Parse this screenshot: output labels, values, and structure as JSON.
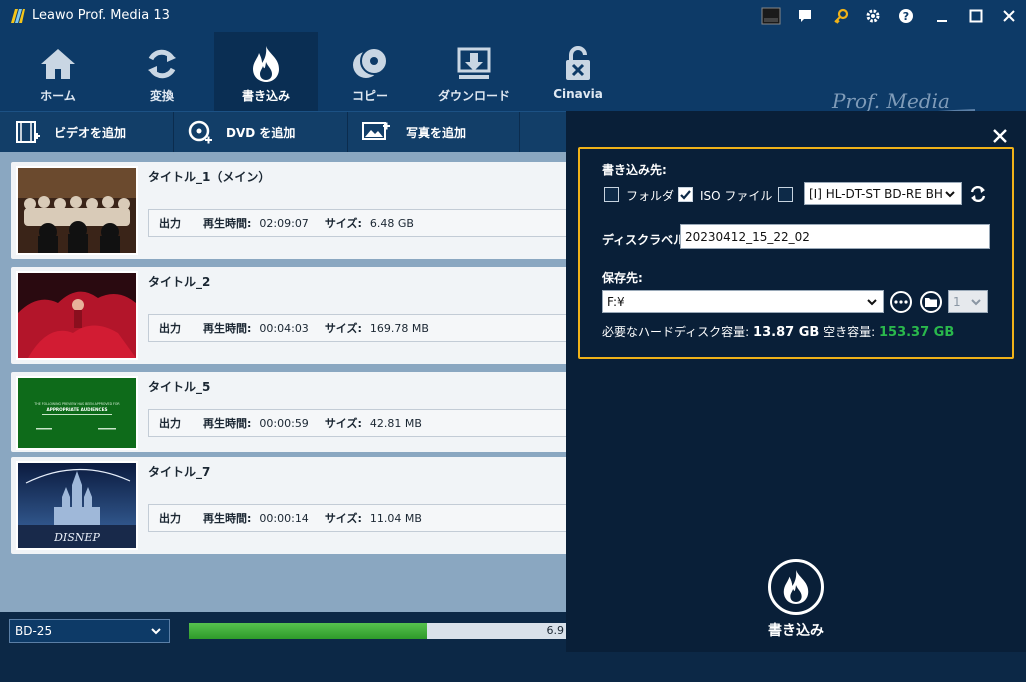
{
  "window": {
    "title": "Leawo Prof. Media 13",
    "brand": "Prof. Media"
  },
  "nav": {
    "items": [
      {
        "label": "ホーム",
        "icon": "home-icon"
      },
      {
        "label": "変換",
        "icon": "convert-icon"
      },
      {
        "label": "書き込み",
        "icon": "burn-icon",
        "active": true
      },
      {
        "label": "コピー",
        "icon": "copy-disc-icon"
      },
      {
        "label": "ダウンロード",
        "icon": "download-icon"
      },
      {
        "label": "Cinavia",
        "icon": "cinavia-lock-icon"
      }
    ]
  },
  "toolbar": {
    "add_video": "ビデオを追加",
    "add_dvd": "DVD を追加",
    "add_photo": "写真を追加"
  },
  "labels": {
    "output": "出力",
    "duration": "再生時間:",
    "size": "サイズ:"
  },
  "items": [
    {
      "title": "タイトル_1（メイン）",
      "duration": "02:09:07",
      "size": "6.48 GB"
    },
    {
      "title": "タイトル_2",
      "duration": "00:04:03",
      "size": "169.78 MB"
    },
    {
      "title": "タイトル_5",
      "duration": "00:00:59",
      "size": "42.81 MB"
    },
    {
      "title": "タイトル_7",
      "duration": "00:00:14",
      "size": "11.04 MB"
    }
  ],
  "thumb_text": {
    "rating_line1": "THE FOLLOWING PREVIEW HAS BEEN APPROVED FOR",
    "rating_line2": "APPROPRIATE AUDIENCES",
    "disney": "DISNEP"
  },
  "bottom": {
    "disc_type": "BD-25",
    "progress_text": "6.9",
    "progress_fraction": 0.63
  },
  "settings": {
    "target_label": "書き込み先:",
    "folder_label": "フォルダ",
    "folder_checked": false,
    "iso_label": "ISO ファイル",
    "iso_checked": true,
    "drive_checked": false,
    "drive_value": "[I] HL-DT-ST BD-RE BH",
    "disc_label_caption": "ディスクラベル:",
    "disc_label_value": "20230412_15_22_02",
    "save_to_caption": "保存先:",
    "save_to_value": "F:¥",
    "copies_value": "1",
    "capacity_text": "必要なハードディスク容量:",
    "capacity_value": "13.87 GB",
    "free_text": "空き容量:",
    "free_value": "153.37 GB"
  },
  "burn_label": "書き込み",
  "colors": {
    "accent": "#f0b219",
    "nav_bg": "#0d3a67",
    "panel_bg": "#091f38",
    "free_space": "#2ab84c"
  }
}
